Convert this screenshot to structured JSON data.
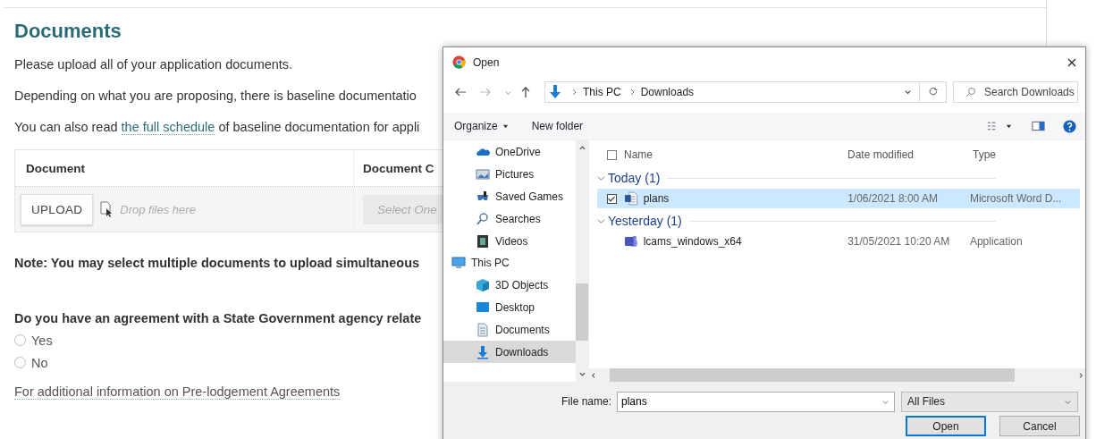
{
  "page": {
    "heading": "Documents",
    "paragraphs": [
      {
        "text": "Please upload all of your application documents."
      },
      {
        "text": "Depending on what you are proposing, there is baseline documentatio"
      },
      {
        "text": "You can also read ",
        "link": "the full schedule",
        "after": " of baseline documentation for appli"
      }
    ],
    "table": {
      "columns": [
        "Document",
        "Document C"
      ],
      "upload_button": "UPLOAD",
      "drop_hint": "Drop files here",
      "category_placeholder": "Select One"
    },
    "note": "Note: You may select multiple documents to upload simultaneous",
    "question": "Do you have an agreement with a State Government agency relate",
    "options": [
      {
        "label": "Yes",
        "selected": false
      },
      {
        "label": "No",
        "selected": false
      }
    ],
    "info_link": "For additional information on Pre-lodgement Agreements"
  },
  "dialog": {
    "title": "Open",
    "path": [
      "This PC",
      "Downloads"
    ],
    "search_placeholder": "Search Downloads",
    "toolbar": {
      "organize": "Organize",
      "new_folder": "New folder"
    },
    "nav_items": [
      {
        "label": "OneDrive",
        "kind": "cloud",
        "selected": false
      },
      {
        "label": "Pictures",
        "kind": "pictures",
        "selected": false
      },
      {
        "label": "Saved Games",
        "kind": "games",
        "selected": false
      },
      {
        "label": "Searches",
        "kind": "search",
        "selected": false
      },
      {
        "label": "Videos",
        "kind": "videos",
        "selected": false
      },
      {
        "label": "This PC",
        "kind": "pc",
        "selected": false,
        "children": [
          {
            "label": "3D Objects",
            "kind": "objects",
            "selected": false
          },
          {
            "label": "Desktop",
            "kind": "desktop",
            "selected": false
          },
          {
            "label": "Documents",
            "kind": "documents",
            "selected": false
          },
          {
            "label": "Downloads",
            "kind": "downloads",
            "selected": true
          }
        ]
      }
    ],
    "columns": [
      "Name",
      "Date modified",
      "Type"
    ],
    "select_all_checked": false,
    "groups": [
      {
        "label": "Today (1)",
        "expanded": true,
        "files": [
          {
            "name": "plans",
            "date": "1/06/2021 8:00 AM",
            "type": "Microsoft Word D...",
            "kind": "word",
            "selected": true,
            "checked": true
          }
        ]
      },
      {
        "label": "Yesterday (1)",
        "expanded": true,
        "files": [
          {
            "name": "lcams_windows_x64",
            "date": "31/05/2021 10:20 AM",
            "type": "Application",
            "kind": "app",
            "selected": false
          }
        ]
      }
    ],
    "file_name_label": "File name:",
    "file_name": "plans",
    "filter": "All Files",
    "buttons": [
      {
        "label": "Open",
        "kind": "primary"
      },
      {
        "label": "Cancel",
        "kind": "secondary"
      }
    ]
  }
}
